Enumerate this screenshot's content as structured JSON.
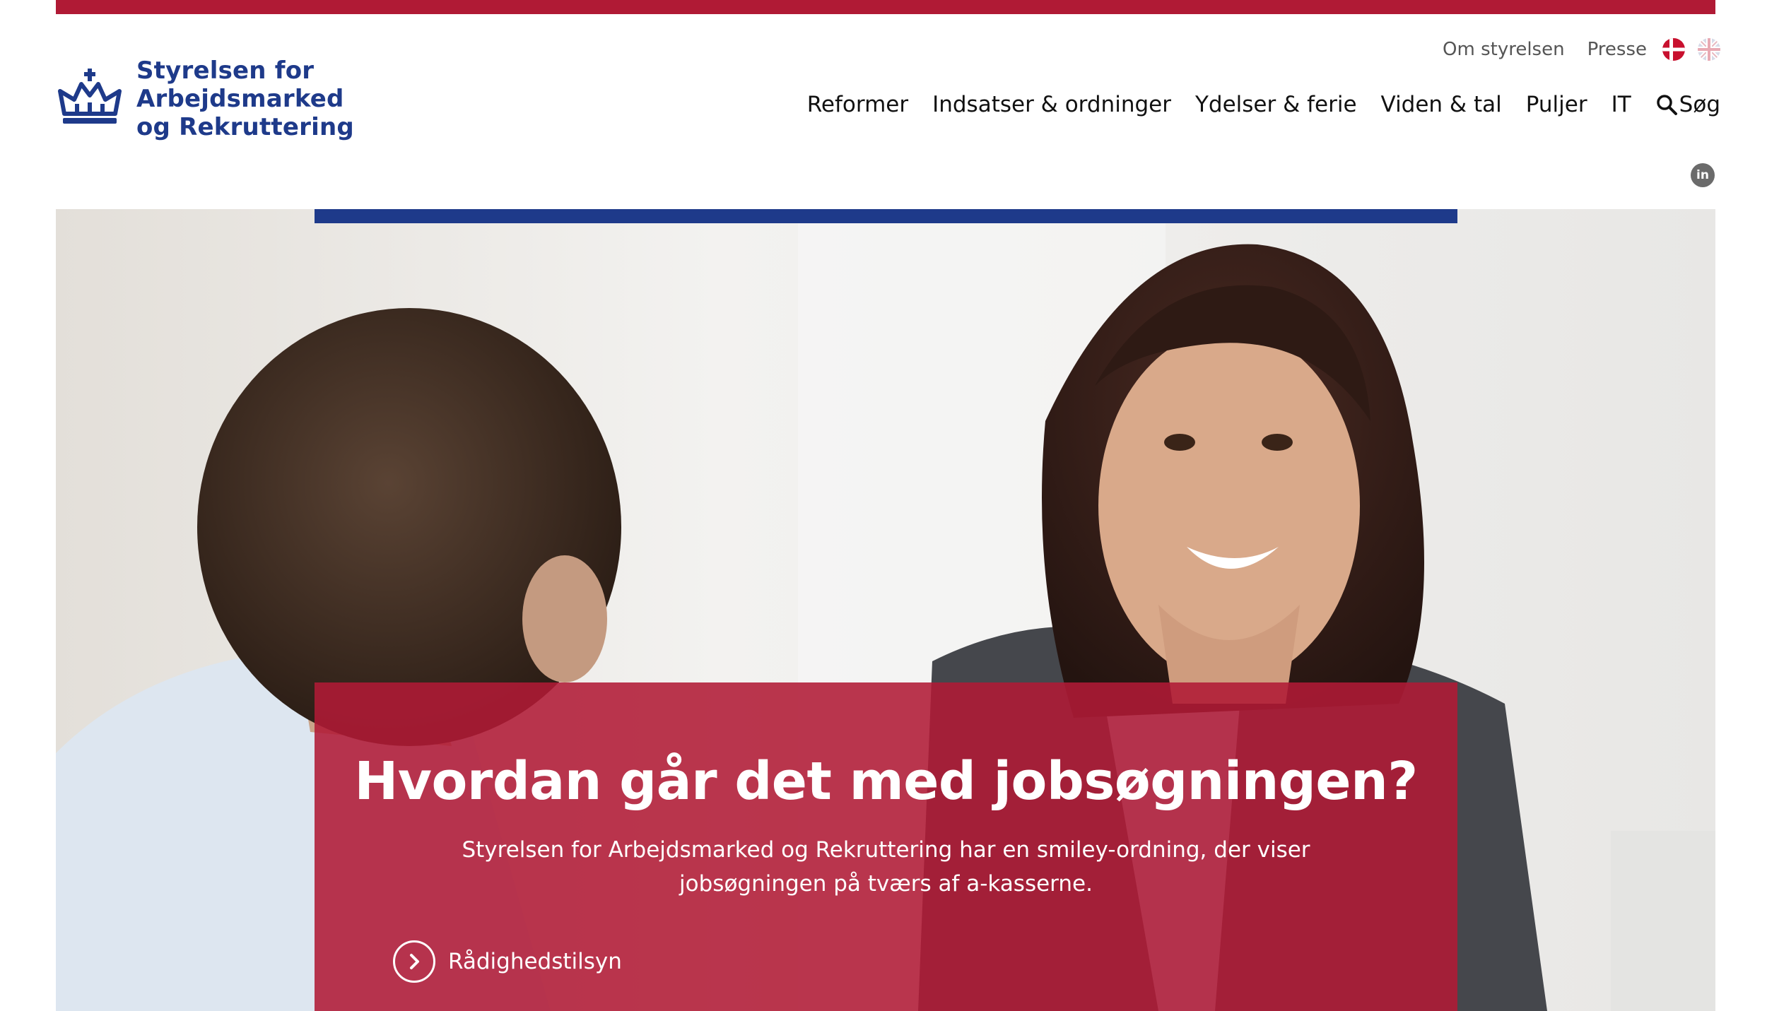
{
  "brand": {
    "name_line1": "Styrelsen for Arbejdsmarked",
    "name_line2": "og Rekruttering",
    "color_primary": "#1e3a8a",
    "color_accent": "#b01a35"
  },
  "utility_nav": {
    "items": [
      {
        "label": "Om styrelsen"
      },
      {
        "label": "Presse"
      }
    ],
    "languages": [
      {
        "icon": "danish-flag-icon"
      },
      {
        "icon": "uk-flag-icon"
      }
    ]
  },
  "main_nav": {
    "items": [
      {
        "label": "Reformer"
      },
      {
        "label": "Indsatser & ordninger"
      },
      {
        "label": "Ydelser & ferie"
      },
      {
        "label": "Viden & tal"
      },
      {
        "label": "Puljer"
      },
      {
        "label": "IT"
      }
    ],
    "search_label": "Søg"
  },
  "social": {
    "linkedin_text": "in"
  },
  "hero": {
    "title": "Hvordan går det med jobsøgningen?",
    "text": "Styrelsen for Arbejdsmarked og Rekruttering har en smiley-ordning, der viser jobsøgningen på tværs af a-kasserne.",
    "cta_label": "Rådighedstilsyn"
  }
}
